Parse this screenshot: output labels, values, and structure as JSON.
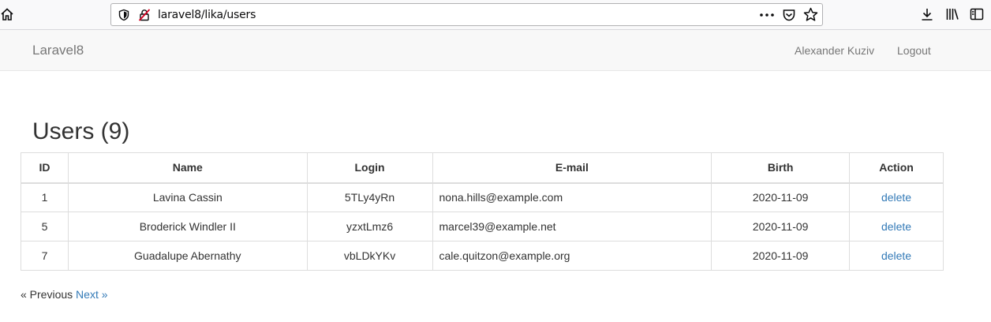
{
  "browser": {
    "url": "laravel8/lika/users",
    "icons": [
      "home-icon",
      "shield-icon",
      "insecure-icon",
      "more-icon",
      "pocket-icon",
      "star-icon",
      "download-icon",
      "library-icon",
      "sidebar-icon"
    ]
  },
  "navbar": {
    "brand": "Laravel8",
    "user_name": "Alexander Kuziv",
    "logout": "Logout"
  },
  "page": {
    "title": "Users (9)"
  },
  "table": {
    "headers": [
      "ID",
      "Name",
      "Login",
      "E-mail",
      "Birth",
      "Action"
    ],
    "rows": [
      {
        "id": "1",
        "name": "Lavina Cassin",
        "login": "5TLy4yRn",
        "email": "nona.hills@example.com",
        "birth": "2020-11-09",
        "action": "delete"
      },
      {
        "id": "5",
        "name": "Broderick Windler II",
        "login": "yzxtLmz6",
        "email": "marcel39@example.net",
        "birth": "2020-11-09",
        "action": "delete"
      },
      {
        "id": "7",
        "name": "Guadalupe Abernathy",
        "login": "vbLDkYKv",
        "email": "cale.quitzon@example.org",
        "birth": "2020-11-09",
        "action": "delete"
      }
    ]
  },
  "pagination": {
    "previous": "« Previous",
    "next": "Next »"
  },
  "colors": {
    "link": "#337ab7",
    "navbar_bg": "#f8f8f8",
    "nav_text": "#777777"
  }
}
